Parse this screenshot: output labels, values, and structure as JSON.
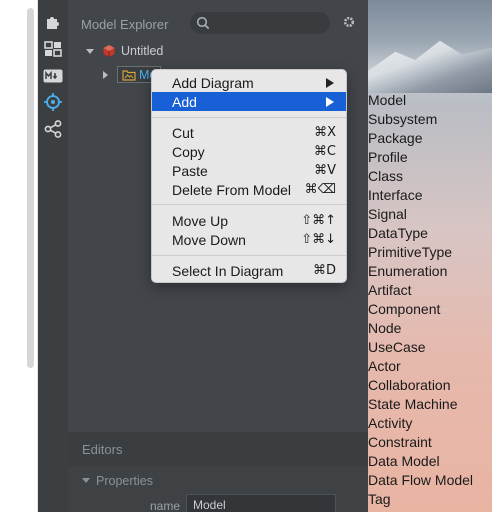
{
  "explorer": {
    "title": "Model Explorer",
    "root_label": "Untitled",
    "child_label": "Mo"
  },
  "editors": {
    "title": "Editors"
  },
  "properties": {
    "title": "Properties",
    "name_label": "name",
    "name_value": "Model"
  },
  "context_menu": {
    "items": [
      {
        "label": "Add Diagram",
        "shortcut": ""
      },
      {
        "label": "Add",
        "shortcut": ""
      },
      {
        "label": "Cut",
        "shortcut": "⌘X"
      },
      {
        "label": "Copy",
        "shortcut": "⌘C"
      },
      {
        "label": "Paste",
        "shortcut": "⌘V"
      },
      {
        "label": "Delete From Model",
        "shortcut": "⌘⌫"
      },
      {
        "label": "Move Up",
        "shortcut": "⇧⌘↑"
      },
      {
        "label": "Move Down",
        "shortcut": "⇧⌘↓"
      },
      {
        "label": "Select In Diagram",
        "shortcut": "⌘D"
      }
    ]
  },
  "submenu": {
    "items": [
      "Model",
      "Subsystem",
      "Package",
      "Profile",
      "Class",
      "Interface",
      "Signal",
      "DataType",
      "PrimitiveType",
      "Enumeration",
      "Artifact",
      "Component",
      "Node",
      "UseCase",
      "Actor",
      "Collaboration",
      "State Machine",
      "Activity",
      "Constraint",
      "Data Model",
      "Data Flow Model",
      "Tag"
    ]
  },
  "colors": {
    "highlight": "#1860d6",
    "panel": "#42464a",
    "rail_accent": "#4ab0f0"
  }
}
